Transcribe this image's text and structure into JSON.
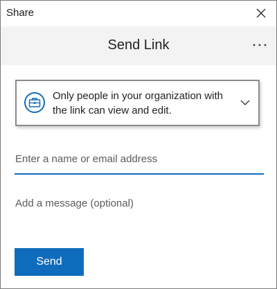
{
  "window": {
    "title": "Share"
  },
  "header": {
    "heading": "Send Link"
  },
  "permission": {
    "text": "Only people in your organization with the link can view and edit."
  },
  "recipient": {
    "placeholder": "Enter a name or email address",
    "value": ""
  },
  "message": {
    "placeholder": "Add a message (optional)",
    "value": ""
  },
  "actions": {
    "send_label": "Send"
  },
  "icons": {
    "close": "close-icon",
    "more": "more-options-icon",
    "permission": "briefcase-icon",
    "dropdown": "chevron-down-icon"
  },
  "colors": {
    "accent": "#0f6cbd",
    "header_bg": "#f3f3f3",
    "border": "#8a8a8a"
  }
}
